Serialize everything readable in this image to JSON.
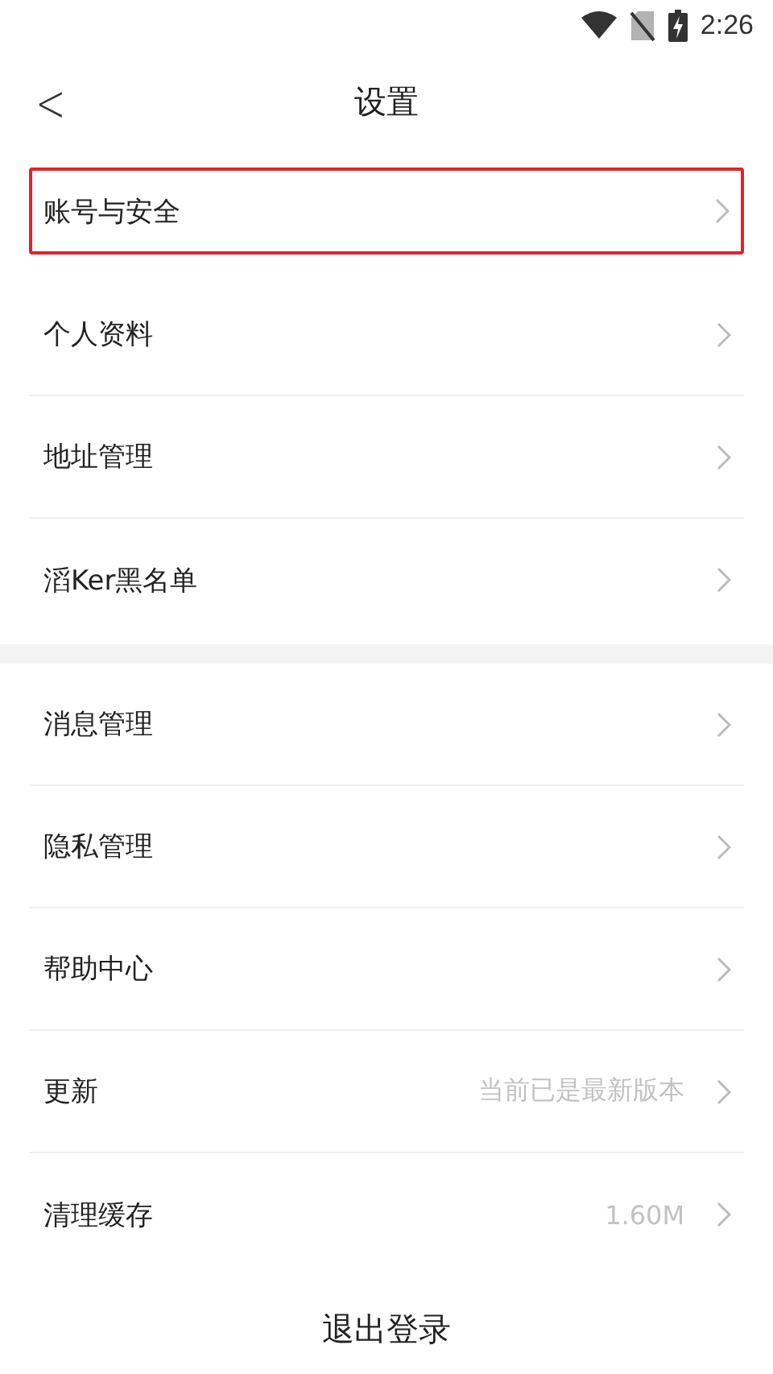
{
  "status_bar": {
    "time": "2:26"
  },
  "header": {
    "back": "<",
    "title": "设置"
  },
  "groups": [
    {
      "items": [
        {
          "label": "账号与安全",
          "highlighted": true
        },
        {
          "label": "个人资料",
          "highlighted": false
        },
        {
          "label": "地址管理",
          "highlighted": false
        },
        {
          "label": "滔Ker黑名单",
          "highlighted": false
        }
      ]
    },
    {
      "items": [
        {
          "label": "消息管理",
          "highlighted": false
        },
        {
          "label": "隐私管理",
          "highlighted": false
        },
        {
          "label": "帮助中心",
          "highlighted": false
        },
        {
          "label": "更新",
          "value": "当前已是最新版本",
          "highlighted": false
        },
        {
          "label": "清理缓存",
          "value": "1.60M",
          "highlighted": false
        }
      ]
    }
  ],
  "logout": "退出登录"
}
